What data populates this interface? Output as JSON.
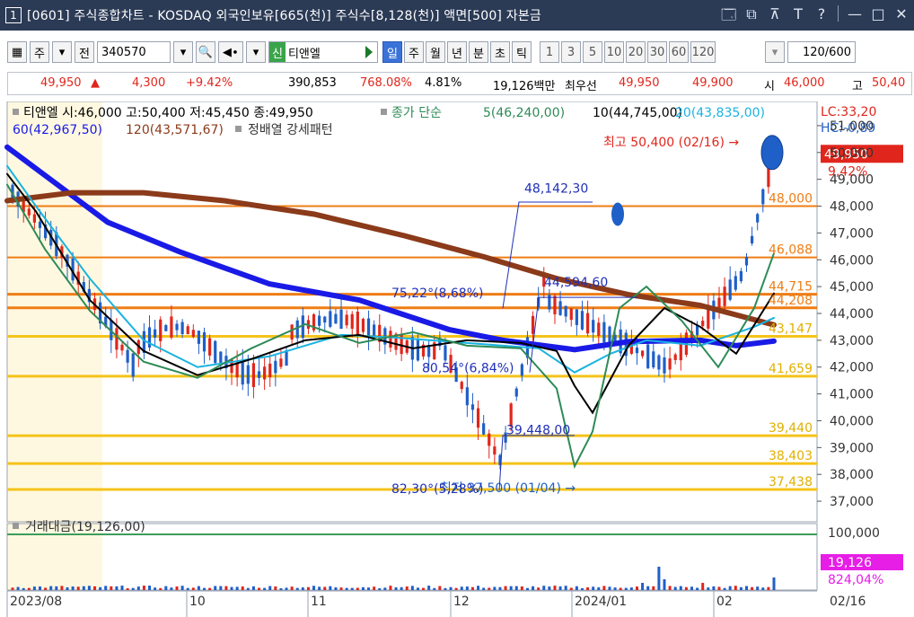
{
  "window": {
    "number": "1",
    "title": "[0601] 주식종합차트 - KOSDAQ 외국인보유[665(천)] 주식수[8,128(천)] 액면[500] 자본금",
    "icons": [
      "restore-window-icon",
      "new-window-icon",
      "pin-icon",
      "font-icon",
      "help-icon",
      "minimize-icon",
      "maximize-icon",
      "close-icon"
    ],
    "icon_glyphs": [
      "🗔",
      "⧉",
      "⊼",
      "T",
      "?",
      "—",
      "□",
      "✕"
    ]
  },
  "toolbar": {
    "layout_btn": "▦",
    "type_label": "주",
    "prev_label": "전",
    "code": "340570",
    "search_glyph": "🔍",
    "sound_glyph": "◀∙",
    "name_tag": "신",
    "name": "티앤엘",
    "period_tabs": [
      "일",
      "주",
      "월",
      "년",
      "분",
      "초",
      "틱"
    ],
    "active_period": "일",
    "interval_nums": [
      "1",
      "3",
      "5",
      "10",
      "20",
      "30",
      "60",
      "120"
    ],
    "count_value": "120",
    "count_total": "/600"
  },
  "quote": {
    "price": "49,950",
    "arrow": "▲",
    "change": "4,300",
    "change_pct": "+9.42%",
    "volume": "390,853",
    "volume_pct": "768.08%",
    "turnover": "4.81%",
    "amount": "19,126백만",
    "best_label": "최우선",
    "ask": "49,950",
    "bid": "49,900",
    "open_label": "시",
    "open": "46,000",
    "high_label": "고",
    "high": "50,40"
  },
  "chart_info": {
    "ohlc_line": "티앤엘 시:46,000 고:50,400 저:45,450 종:49,950",
    "ma_label": "종가 단순",
    "ma5": "5(46,240,00)",
    "ma10": "10(44,745,00)",
    "ma20": "20(43,835,00)",
    "ma60": "60(42,967,50)",
    "ma120": "120(43,571,67)",
    "pattern": "정배열 강세패턴",
    "lc": "LC:33,20",
    "hc": "HC:-0,89",
    "high_annotation": "최고 50,400 (02/16) →",
    "low_annotation": "최저 37,500 (01/04) →",
    "fib_labels": [
      {
        "text": "48,142,30"
      },
      {
        "text": "75,22°(8,68%)"
      },
      {
        "text": "44,594,60"
      },
      {
        "text": "80,54°(6,84%)"
      },
      {
        "text": "39,448,00"
      },
      {
        "text": "82,30°(5,28%)"
      }
    ],
    "hline_labels": [
      "48,000",
      "46,088",
      "44,715",
      "44,208",
      "43,147",
      "41,659",
      "39,440",
      "38,403",
      "37,438"
    ],
    "price_badge": "49,950",
    "price_badge_pct": "9,42%",
    "volume_label": "거래대금(19,126,00)",
    "volume_badge": "19,126",
    "volume_badge_pct": "824,04%",
    "volume_axis_label": "100,000",
    "date_labels": [
      "2023/08",
      "10",
      "11",
      "12",
      "2024/01",
      "02"
    ],
    "last_date": "02/16"
  },
  "chart_data": {
    "type": "candlestick",
    "y_ticks": [
      51000,
      50000,
      49000,
      48000,
      47000,
      46000,
      45000,
      44000,
      43000,
      42000,
      41000,
      40000,
      39000,
      38000,
      37000
    ],
    "ylim": [
      36500,
      51700
    ],
    "x_ticks": [
      "2023/08",
      "10",
      "11",
      "12",
      "2024/01",
      "02"
    ],
    "last": {
      "open": 46000,
      "high": 50400,
      "low": 45450,
      "close": 49950,
      "change": 4300,
      "change_pct": 9.42
    },
    "moving_averages": [
      {
        "name": "5",
        "value": 46240,
        "color": "#2e8b57"
      },
      {
        "name": "10",
        "value": 44745,
        "color": "#000000"
      },
      {
        "name": "20",
        "value": 43835,
        "color": "#1ab3e0"
      },
      {
        "name": "60",
        "value": 42967.5,
        "color": "#1a1ae6"
      },
      {
        "name": "120",
        "value": 43571.67,
        "color": "#8b3a1a"
      }
    ],
    "horizontal_lines": [
      48000,
      46088,
      44715,
      44208,
      43147,
      41659,
      39440,
      38403,
      37438
    ],
    "period_high": {
      "value": 50400,
      "date": "02/16"
    },
    "period_low": {
      "value": 37500,
      "date": "01/04"
    },
    "volume_last": 19126
  },
  "colors": {
    "up": "#e0261c",
    "down": "#1f5fc8",
    "accent": "#3a72d8",
    "hline_orange": "#ef7d14",
    "hline_yellow": "#f5c31a",
    "highlight_bg": "#fff8e1"
  }
}
